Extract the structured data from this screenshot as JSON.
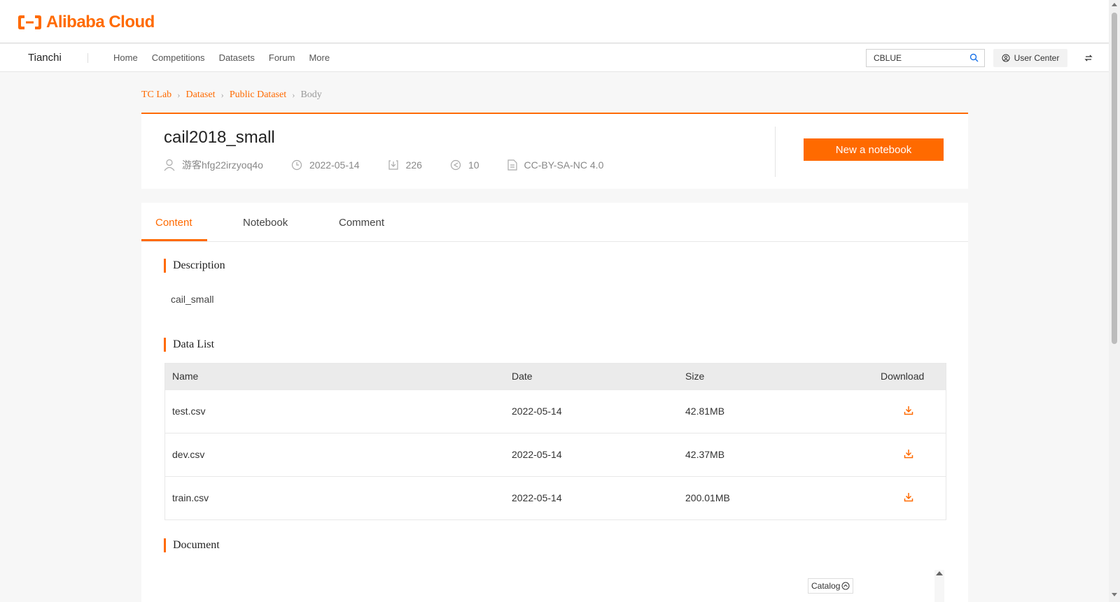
{
  "logo": {
    "text": "Alibaba Cloud"
  },
  "nav": {
    "brand": "Tianchi",
    "links": [
      "Home",
      "Competitions",
      "Datasets",
      "Forum",
      "More"
    ],
    "search_value": "CBLUE",
    "user_center": "User Center"
  },
  "breadcrumb": {
    "items": [
      "TC Lab",
      "Dataset",
      "Public Dataset"
    ],
    "current": "Body"
  },
  "dataset": {
    "title": "cail2018_small",
    "author": "游客hfg22irzyoq4o",
    "date": "2022-05-14",
    "downloads": "226",
    "shares": "10",
    "license": "CC-BY-SA-NC 4.0",
    "new_notebook_label": "New a notebook"
  },
  "tabs": [
    "Content",
    "Notebook",
    "Comment"
  ],
  "description": {
    "heading": "Description",
    "text": "cail_small"
  },
  "data_list": {
    "heading": "Data List",
    "columns": [
      "Name",
      "Date",
      "Size",
      "Download"
    ],
    "rows": [
      {
        "name": "test.csv",
        "date": "2022-05-14",
        "size": "42.81MB"
      },
      {
        "name": "dev.csv",
        "date": "2022-05-14",
        "size": "42.37MB"
      },
      {
        "name": "train.csv",
        "date": "2022-05-14",
        "size": "200.01MB"
      }
    ]
  },
  "document": {
    "heading": "Document",
    "catalog_label": "Catalog"
  },
  "colors": {
    "accent": "#ff6a00",
    "muted": "#888888"
  }
}
